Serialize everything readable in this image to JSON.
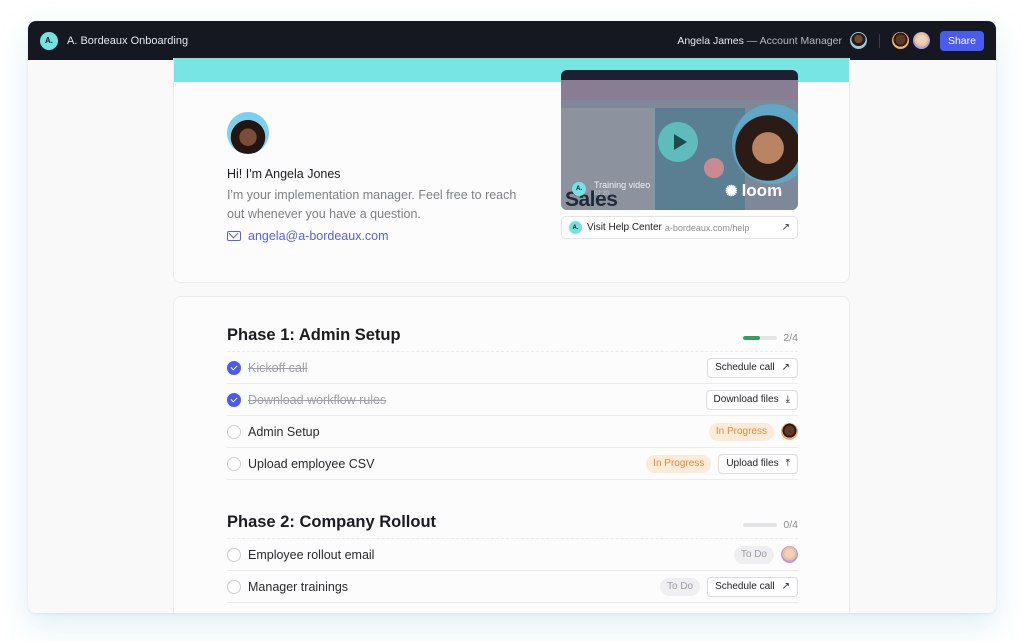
{
  "topbar": {
    "logo_text": "A.",
    "app_title": "A. Bordeaux Onboarding",
    "owner_name": "Angela James",
    "owner_separator": " — ",
    "owner_role": "Account Manager",
    "share_label": "Share"
  },
  "hero": {
    "greeting": "Hi! I'm Angela Jones",
    "description": "I'm your implementation manager. Feel free to reach out whenever you have a question.",
    "email": "angela@a-bordeaux.com",
    "video": {
      "badge": "A.",
      "title": "Training video",
      "duration": "02:20",
      "overlay_text": "Sales",
      "brand": "loom"
    },
    "help_link": {
      "badge": "A.",
      "title": "Visit Help Center",
      "url": "a-bordeaux.com/help",
      "icon": "↗"
    }
  },
  "phases": [
    {
      "title": "Phase 1: Admin Setup",
      "completed": 2,
      "total": 4,
      "progress_label": "2/4",
      "progress_fraction": 0.5,
      "tasks": [
        {
          "label": "Kickoff call",
          "done": true,
          "status": null,
          "action": "Schedule call",
          "action_icon": "↗",
          "assignee": null
        },
        {
          "label": "Download workflow rules",
          "done": true,
          "status": null,
          "action": "Download files",
          "action_icon": "⤓",
          "assignee": null
        },
        {
          "label": "Admin Setup",
          "done": false,
          "status": "In Progress",
          "action": null,
          "action_icon": null,
          "assignee": "avatar-male"
        },
        {
          "label": "Upload employee CSV",
          "done": false,
          "status": "In Progress",
          "action": "Upload files",
          "action_icon": "⤒",
          "assignee": null
        }
      ]
    },
    {
      "title": "Phase 2: Company Rollout",
      "completed": 0,
      "total": 4,
      "progress_label": "0/4",
      "progress_fraction": 0,
      "tasks": [
        {
          "label": "Employee rollout email",
          "done": false,
          "status": "To Do",
          "action": null,
          "action_icon": null,
          "assignee": "avatar-female"
        },
        {
          "label": "Manager trainings",
          "done": false,
          "status": "To Do",
          "action": "Schedule call",
          "action_icon": "↗",
          "assignee": null
        }
      ]
    }
  ]
}
